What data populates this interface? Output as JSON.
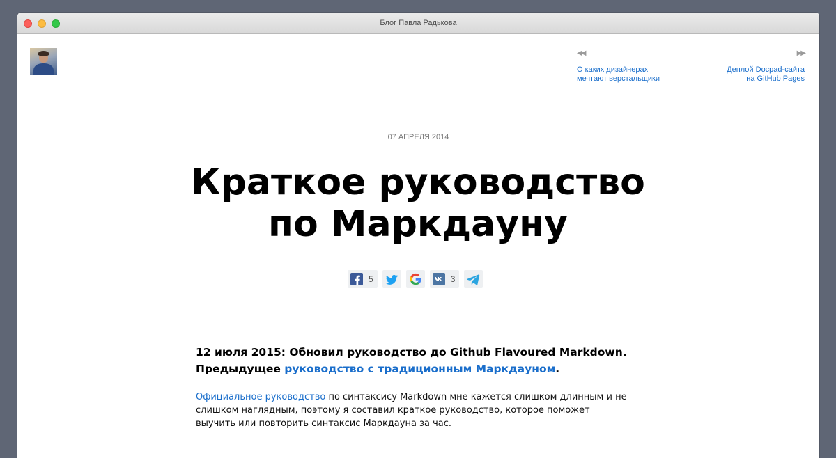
{
  "window": {
    "title": "Блог Павла Радькова"
  },
  "nav": {
    "prev": {
      "arrows": "◀◀",
      "line1": "О каких дизайнерах",
      "line2": "мечтают верстальщики"
    },
    "next": {
      "arrows": "▶▶",
      "line1": "Деплой Docpad-сайта",
      "line2": "на GitHub Pages"
    }
  },
  "post": {
    "date": "07 АПРЕЛЯ 2014",
    "title_line1": "Краткое руководство",
    "title_line2": "по Маркдауну"
  },
  "share": {
    "facebook": {
      "icon": "facebook-icon",
      "count": "5",
      "color": "#3b5998"
    },
    "twitter": {
      "icon": "twitter-icon",
      "color": "#1da1f2"
    },
    "google": {
      "icon": "google-icon"
    },
    "vk": {
      "icon": "vk-icon",
      "count": "3",
      "color": "#4c75a3"
    },
    "telegram": {
      "icon": "telegram-icon",
      "color": "#2ca5e0"
    }
  },
  "lead": {
    "part1": "12 июля 2015: Обновил руководство до Github Flavoured Markdown.",
    "part2": "Предыдущее ",
    "link": "руководство с традиционным Маркдауном",
    "part3": "."
  },
  "para": {
    "link": "Официальное руководство",
    "text": " по синтаксису Markdown мне кажется слишком длинным и не слишком наглядным, поэтому я составил краткое руководство, которое поможет выучить или повторить синтаксис Маркдауна за час."
  },
  "colors": {
    "link": "#1a6ecb",
    "background": "#5f6675"
  }
}
